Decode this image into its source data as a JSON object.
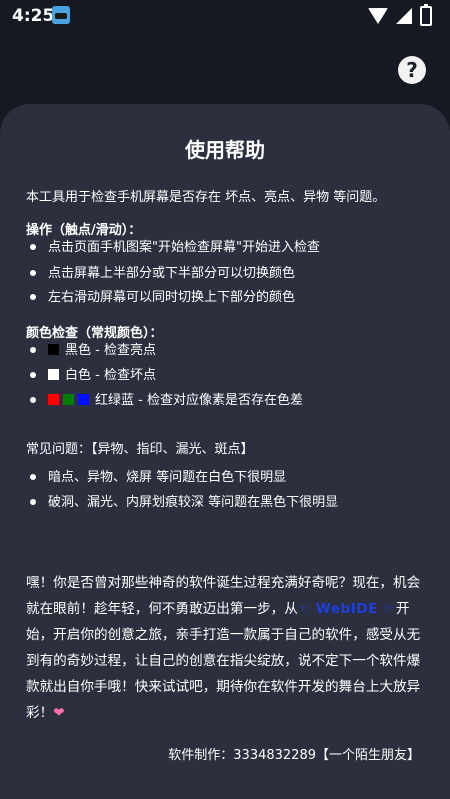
{
  "status": {
    "time": "4:25"
  },
  "card": {
    "title": "使用帮助",
    "intro": "本工具用于检查手机屏幕是否存在 坏点、亮点、异物 等问题。",
    "ops_title": "操作（触点/滑动）：",
    "ops": [
      "点击页面手机图案\"开始检查屏幕\"开始进入检查",
      "点击屏幕上半部分或下半部分可以切换颜色",
      "左右滑动屏幕可以同时切换上下部分的颜色"
    ],
    "color_title": "颜色检查（常规颜色）：",
    "colors": [
      "黑色 - 检查亮点",
      "白色 - 检查坏点",
      "红绿蓝 - 检查对应像素是否存在色差"
    ],
    "faq_title": "常见问题：【异物、指印、漏光、斑点】",
    "faq": [
      "暗点、异物、烧屏 等问题在白色下很明显",
      "破洞、漏光、内屏划痕较深 等问题在黑色下很明显"
    ],
    "para_1": "嘿！你是否曾对那些神奇的软件诞生过程充满好奇呢？现在，机会就在眼前！趁年轻，何不勇敢迈出第一步，从",
    "webide": "☜ WebIDE ☞",
    "para_2": "开始，开启你的创意之旅，亲手打造一款属于自己的软件，感受从无到有的奇妙过程，让自己的创意在指尖绽放，说不定下一个软件爆款就出自你手哦！快来试试吧，期待你在软件开发的舞台上大放异彩！",
    "heart": "❤",
    "credit": "软件制作：3334832289【一个陌生朋友】"
  }
}
